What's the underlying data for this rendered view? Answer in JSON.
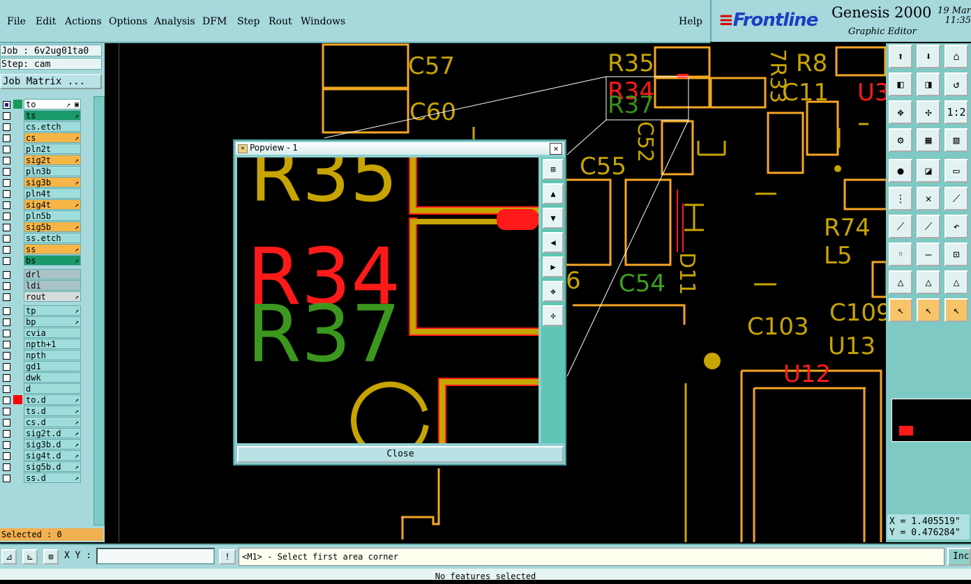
{
  "menu": [
    "File",
    "Edit",
    "Actions",
    "Options",
    "Analysis",
    "DFM",
    "Step",
    "Rout",
    "Windows"
  ],
  "help": "Help",
  "brand": {
    "logo": "Frontline",
    "title": "Genesis 2000",
    "subtitle": "Graphic Editor",
    "date": "19 Mar",
    "time": "11:35"
  },
  "job": {
    "job": "Job : 6v2ug01ta0",
    "step": "Step: cam",
    "matrix_button": "Job Matrix ..."
  },
  "layers": [
    {
      "name": "to",
      "color": "#ffffff",
      "swatch": "#1a9a5a",
      "selected": true,
      "arrow": "↗ ▣"
    },
    {
      "name": "ts",
      "color": "#1a9a6a",
      "swatch": "",
      "selected": false,
      "arrow": "↗"
    },
    {
      "name": "cs.etch",
      "color": "#9edddc",
      "swatch": "",
      "selected": false,
      "arrow": ""
    },
    {
      "name": "cs",
      "color": "#f7b548",
      "swatch": "",
      "selected": false,
      "arrow": "↗"
    },
    {
      "name": "pln2t",
      "color": "#9edddc",
      "swatch": "",
      "selected": false,
      "arrow": ""
    },
    {
      "name": "sig2t",
      "color": "#f7b548",
      "swatch": "",
      "selected": false,
      "arrow": "↗"
    },
    {
      "name": "pln3b",
      "color": "#9edddc",
      "swatch": "",
      "selected": false,
      "arrow": ""
    },
    {
      "name": "sig3b",
      "color": "#f7b548",
      "swatch": "",
      "selected": false,
      "arrow": "↗"
    },
    {
      "name": "pln4t",
      "color": "#9edddc",
      "swatch": "",
      "selected": false,
      "arrow": ""
    },
    {
      "name": "sig4t",
      "color": "#f7b548",
      "swatch": "",
      "selected": false,
      "arrow": "↗"
    },
    {
      "name": "pln5b",
      "color": "#9edddc",
      "swatch": "",
      "selected": false,
      "arrow": ""
    },
    {
      "name": "sig5b",
      "color": "#f7b548",
      "swatch": "",
      "selected": false,
      "arrow": "↗"
    },
    {
      "name": "ss.etch",
      "color": "#9edddc",
      "swatch": "",
      "selected": false,
      "arrow": ""
    },
    {
      "name": "ss",
      "color": "#f7b548",
      "swatch": "",
      "selected": false,
      "arrow": "↗"
    },
    {
      "name": "bs",
      "color": "#1a9a6a",
      "swatch": "",
      "selected": false,
      "arrow": "↗"
    },
    {
      "name": "drl",
      "color": "#aac4c8",
      "swatch": "",
      "selected": false,
      "arrow": ""
    },
    {
      "name": "ldi",
      "color": "#aac4c8",
      "swatch": "",
      "selected": false,
      "arrow": ""
    },
    {
      "name": "rout",
      "color": "#d8dcdc",
      "swatch": "",
      "selected": false,
      "arrow": "↗"
    },
    {
      "name": "tp",
      "color": "#9edddc",
      "swatch": "",
      "selected": false,
      "arrow": "↗"
    },
    {
      "name": "bp",
      "color": "#9edddc",
      "swatch": "",
      "selected": false,
      "arrow": "↗"
    },
    {
      "name": "cvia",
      "color": "#9edddc",
      "swatch": "",
      "selected": false,
      "arrow": ""
    },
    {
      "name": "npth+1",
      "color": "#9edddc",
      "swatch": "",
      "selected": false,
      "arrow": ""
    },
    {
      "name": "npth",
      "color": "#9edddc",
      "swatch": "",
      "selected": false,
      "arrow": ""
    },
    {
      "name": "gd1",
      "color": "#9edddc",
      "swatch": "",
      "selected": false,
      "arrow": ""
    },
    {
      "name": "dwk",
      "color": "#9edddc",
      "swatch": "",
      "selected": false,
      "arrow": ""
    },
    {
      "name": "d",
      "color": "#9edddc",
      "swatch": "",
      "selected": false,
      "arrow": ""
    },
    {
      "name": "to.d",
      "color": "#9edddc",
      "swatch": "#ff0000",
      "selected": false,
      "arrow": "↗"
    },
    {
      "name": "ts.d",
      "color": "#9edddc",
      "swatch": "",
      "selected": false,
      "arrow": "↗"
    },
    {
      "name": "cs.d",
      "color": "#9edddc",
      "swatch": "",
      "selected": false,
      "arrow": "↗"
    },
    {
      "name": "sig2t.d",
      "color": "#9edddc",
      "swatch": "",
      "selected": false,
      "arrow": "↗"
    },
    {
      "name": "sig3b.d",
      "color": "#9edddc",
      "swatch": "",
      "selected": false,
      "arrow": "↗"
    },
    {
      "name": "sig4t.d",
      "color": "#9edddc",
      "swatch": "",
      "selected": false,
      "arrow": "↗"
    },
    {
      "name": "sig5b.d",
      "color": "#9edddc",
      "swatch": "",
      "selected": false,
      "arrow": "↗"
    },
    {
      "name": "ss.d",
      "color": "#9edddc",
      "swatch": "",
      "selected": false,
      "arrow": "↗"
    }
  ],
  "selected_count": "Selected : 0",
  "canvas_labels": [
    "C57",
    "C60",
    "R35",
    "R34",
    "R37",
    "R8",
    "7R33",
    "C11",
    "U3",
    "C55",
    "C52",
    "R74",
    "L5",
    "D11",
    "C54",
    "C103",
    "C109",
    "U13",
    "U12",
    "6"
  ],
  "popview": {
    "title": "Popview - 1",
    "close": "Close",
    "labels": [
      "R35",
      "R34",
      "R37"
    ]
  },
  "coords": {
    "x": "X = 1.405519\"",
    "y": "Y = 0.476284\""
  },
  "bottom": {
    "xy_label": "X Y :",
    "prompt": "<M1> - Select first area corner",
    "inc": "Inc"
  },
  "status": "No features selected",
  "colors": {
    "copper": "#f5a623",
    "silk": "#c8a400",
    "red": "#ff1a1a",
    "green": "#3fa020",
    "panel": "#a6d8dc"
  }
}
